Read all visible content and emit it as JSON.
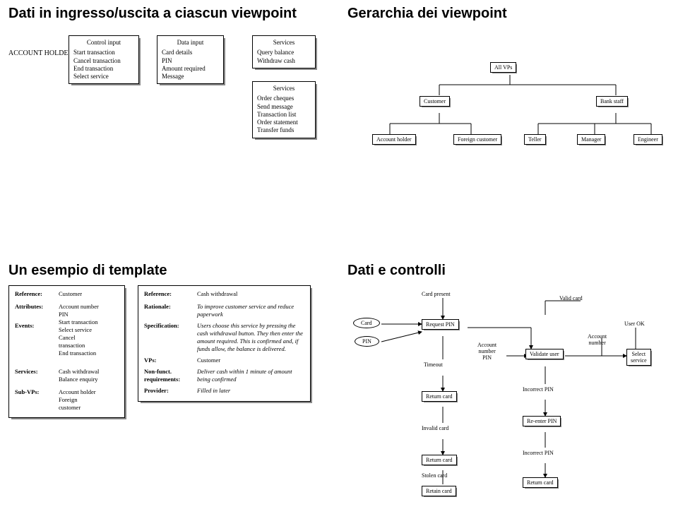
{
  "q1": {
    "title": "Dati in ingresso/uscita a ciascun viewpoint",
    "holder": "ACCOUNT HOLDER",
    "ctrl_hdr": "Control input",
    "ctrl_body": "Start transaction\nCancel transaction\nEnd transaction\nSelect service",
    "data_hdr": "Data input",
    "data_body": "Card details\nPIN\nAmount required\nMessage",
    "svc1_hdr": "Services",
    "svc1_body": "Query balance\nWithdraw cash",
    "svc2_hdr": "Services",
    "svc2_body": "Order cheques\nSend message\nTransaction list\nOrder statement\nTransfer funds"
  },
  "q2": {
    "title": "Gerarchia dei viewpoint",
    "root": "All VPs",
    "l2": [
      "Customer",
      "Bank staff"
    ],
    "l3a": [
      "Account holder",
      "Foreign customer"
    ],
    "l3b": [
      "Teller",
      "Manager",
      "Engineer"
    ]
  },
  "q3": {
    "title": "Un esempio di template",
    "left": {
      "reference": "Customer",
      "attributes": "Account number\nPIN\nStart transaction\nSelect service\nCancel\ntransaction\nEnd transaction",
      "events_k": "Events:",
      "services": "Cash withdrawal\nBalance enquiry",
      "subvps": "Account holder\nForeign\ncustomer"
    },
    "right": {
      "reference": "Cash withdrawal",
      "rationale": "To improve customer service and reduce paperwork",
      "spec": "Users choose this service by pressing the cash withdrawal button. They then enter the amount required. This is confirmed and, if funds allow, the balance is delivered.",
      "vps": "Customer",
      "nonfunc": "Deliver cash within 1 minute of amount being confirmed",
      "provider": "Filled in later"
    }
  },
  "q4": {
    "title": "Dati e controlli",
    "top": "Card present",
    "card": "Card",
    "pin": "PIN",
    "reqpin": "Request PIN",
    "timeout": "Timeout",
    "return1": "Return card",
    "invalid": "Invalid card",
    "return2": "Return card",
    "stolen": "Stolen card",
    "retain": "Retain card",
    "acctnum": "Account\nnumber\nPIN",
    "validcard": "Valid card",
    "validate": "Validate user",
    "incpin1": "Incorrect PIN",
    "reenter": "Re-enter PIN",
    "incpin2": "Incorrect PIN",
    "return3": "Return card",
    "acctnum2": "Account\nnumber",
    "userok": "User OK",
    "select": "Select\nservice"
  }
}
